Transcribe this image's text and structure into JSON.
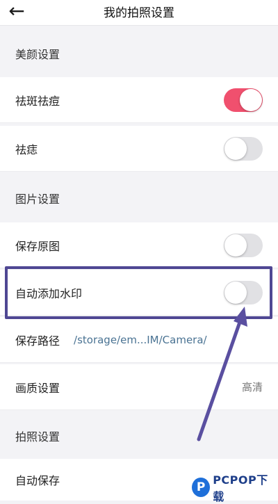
{
  "header": {
    "back_icon": "arrow-left-icon",
    "back_glyph": "←",
    "title": "我的拍照设置"
  },
  "rows": {
    "beauty_section": "美颜设置",
    "spot_removal": {
      "label": "祛斑祛痘",
      "on": true
    },
    "acne_removal": {
      "label": "祛痣",
      "on": false
    },
    "image_section": "图片设置",
    "save_original": {
      "label": "保存原图",
      "on": false
    },
    "auto_watermark": {
      "label": "自动添加水印",
      "on": false
    },
    "save_path": {
      "label": "保存路径",
      "value": "/storage/em...IM/Camera/"
    },
    "quality": {
      "label": "画质设置",
      "value": "高清"
    },
    "capture_section": "拍照设置",
    "auto_save": {
      "label": "自动保存"
    }
  },
  "annotation": {
    "highlight_color": "#4f4793",
    "arrow_color": "#5a4fa0"
  },
  "watermark": {
    "logo_letter": "P",
    "text": "PCPOP下载"
  },
  "colors": {
    "toggle_on": "#f0506e",
    "toggle_off": "#e1e1e4",
    "path_text": "#4a7393"
  }
}
